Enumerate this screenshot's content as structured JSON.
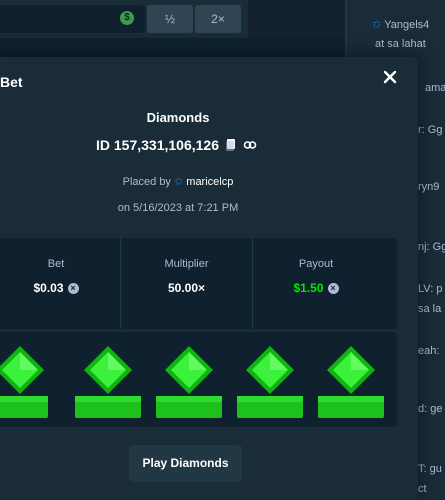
{
  "topbar": {
    "coin_icon": "currency-coin-icon",
    "half_label": "½",
    "double_label": "2×"
  },
  "chat": {
    "lines": [
      {
        "text": "Yangels4"
      },
      {
        "text": "at sa lahat"
      },
      {
        "text": "ama"
      },
      {
        "text": "r: Gg"
      },
      {
        "text": "ryn9"
      },
      {
        "text": "nj: Gg"
      },
      {
        "text": "LV: p"
      },
      {
        "text": "sa la"
      },
      {
        "text": "eah:"
      },
      {
        "text": "d: ge"
      },
      {
        "text": "T: gu"
      },
      {
        "text": "ct"
      }
    ]
  },
  "modal": {
    "title": "Bet",
    "game_name": "Diamonds",
    "bet_id": "ID 157,331,106,126",
    "placed_by_prefix": "Placed by",
    "username": "maricelcp",
    "date": "on 5/16/2023 at 7:21 PM",
    "stats": {
      "bet_label": "Bet",
      "bet_value": "$0.03",
      "multiplier_label": "Multiplier",
      "multiplier_value": "50.00×",
      "payout_label": "Payout",
      "payout_value": "$1.50"
    },
    "gems": [
      {
        "type": "diamond",
        "color": "#00e701"
      },
      {
        "type": "diamond",
        "color": "#00e701"
      },
      {
        "type": "diamond",
        "color": "#00e701"
      },
      {
        "type": "diamond",
        "color": "#00e701"
      },
      {
        "type": "diamond",
        "color": "#00e701"
      }
    ],
    "play_label": "Play Diamonds"
  },
  "colors": {
    "background": "#0f212e",
    "panel": "#1a2c38",
    "accent_green": "#00e701",
    "muted_text": "#b1bad3"
  }
}
